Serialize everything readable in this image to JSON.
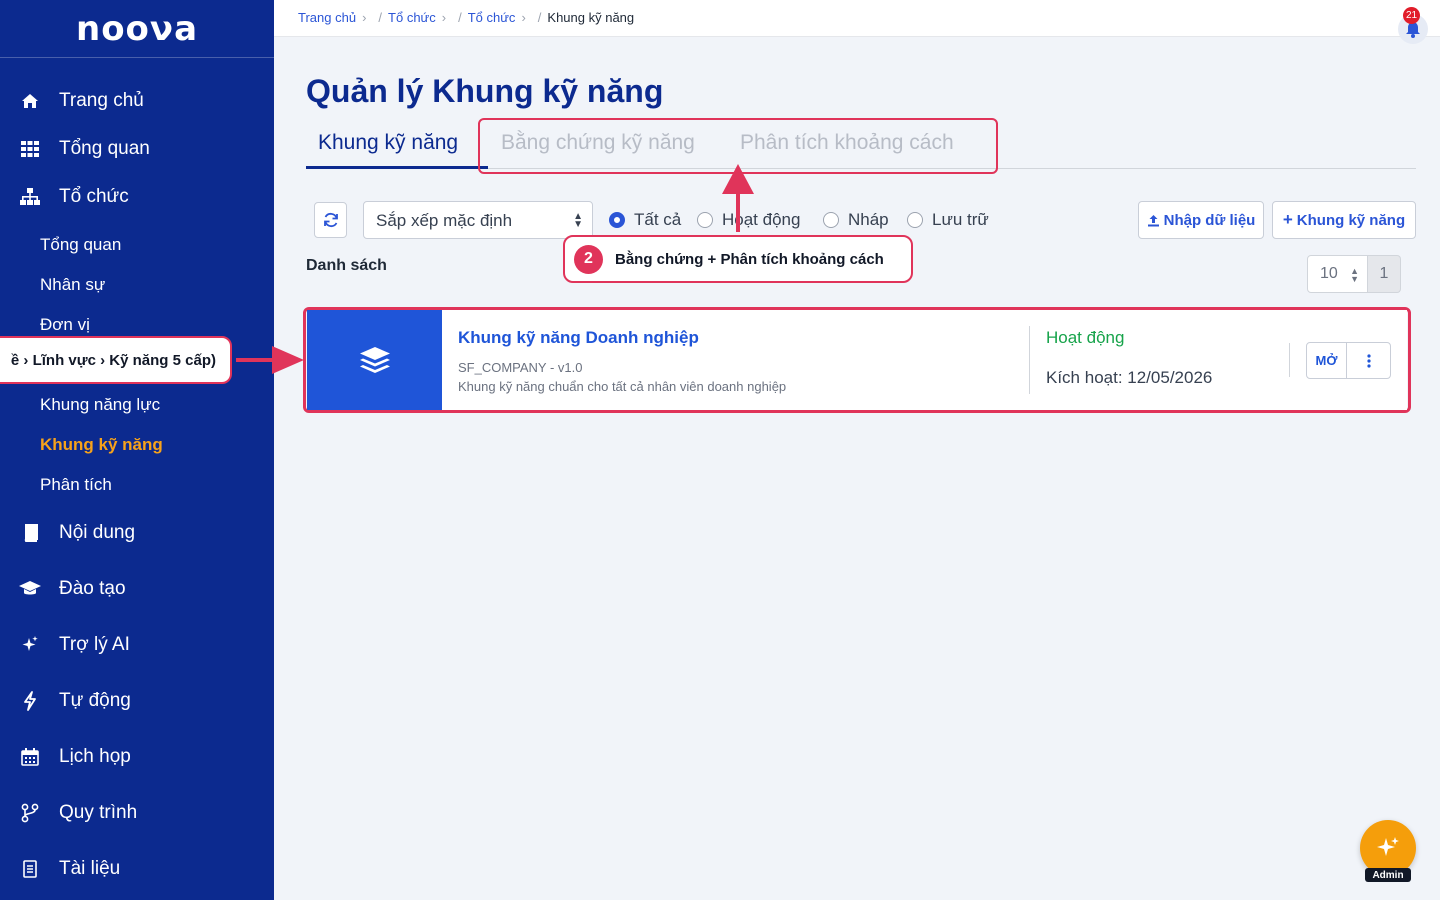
{
  "brand": {
    "logo_text": "nooνa"
  },
  "sidebar": {
    "items": [
      {
        "label": "Trang chủ",
        "icon": "home-icon"
      },
      {
        "label": "Tổng quan",
        "icon": "grid-icon"
      },
      {
        "label": "Tổ chức",
        "icon": "org-chart-icon"
      },
      {
        "label": "Nội dung",
        "icon": "book-icon"
      },
      {
        "label": "Đào tạo",
        "icon": "graduation-cap-icon"
      },
      {
        "label": "Trợ lý AI",
        "icon": "sparkle-icon"
      },
      {
        "label": "Tự động",
        "icon": "bolt-icon"
      },
      {
        "label": "Lịch họp",
        "icon": "calendar-icon"
      },
      {
        "label": "Quy trình",
        "icon": "workflow-icon"
      },
      {
        "label": "Tài liệu",
        "icon": "document-icon"
      }
    ],
    "sub_items": [
      {
        "label": "Tổng quan"
      },
      {
        "label": "Nhân sự"
      },
      {
        "label": "Đơn vị"
      },
      {
        "label": "Khung năng lực"
      },
      {
        "label": "Khung kỹ năng",
        "active": true
      },
      {
        "label": "Phân tích"
      }
    ]
  },
  "breadcrumb": [
    "Trang chủ",
    "Tổ chức",
    "Tổ chức",
    "Khung kỹ năng"
  ],
  "notifications": {
    "count": "21"
  },
  "page": {
    "title": "Quản lý Khung kỹ năng",
    "tabs": [
      "Khung kỹ năng",
      "Bằng chứng kỹ năng",
      "Phân tích khoảng cách"
    ]
  },
  "toolbar": {
    "sort_value": "Sắp xếp mặc định",
    "filters": [
      {
        "label": "Tất cả",
        "checked": true
      },
      {
        "label": "Hoạt động",
        "checked": false
      },
      {
        "label": "Nháp",
        "checked": false
      },
      {
        "label": "Lưu trữ",
        "checked": false
      }
    ],
    "import_label": "Nhập dữ liệu",
    "add_label": "Khung kỹ năng"
  },
  "list": {
    "label": "Danh sách",
    "page_size": "10",
    "page": "1",
    "items": [
      {
        "title": "Khung kỹ năng Doanh nghiệp",
        "code": "SF_COMPANY - v1.0",
        "description": "Khung kỹ năng chuẩn cho tất cả nhân viên doanh nghiệp",
        "status": "Hoạt động",
        "activated": "Kích hoạt: 12/05/2026",
        "open_label": "MỞ"
      }
    ]
  },
  "annotations": {
    "top_number": "2",
    "top_text": "Bằng chứng + Phân tích khoảng cách",
    "left_text": "ề › Lĩnh vực › Kỹ năng 5 cấp)"
  },
  "assistant": {
    "label": "Admin"
  },
  "colors": {
    "sidebar": "#0c2a8f",
    "accent": "#f6a21b",
    "primary": "#1f55d8",
    "highlight": "#e0345a",
    "success": "#16a34a"
  }
}
